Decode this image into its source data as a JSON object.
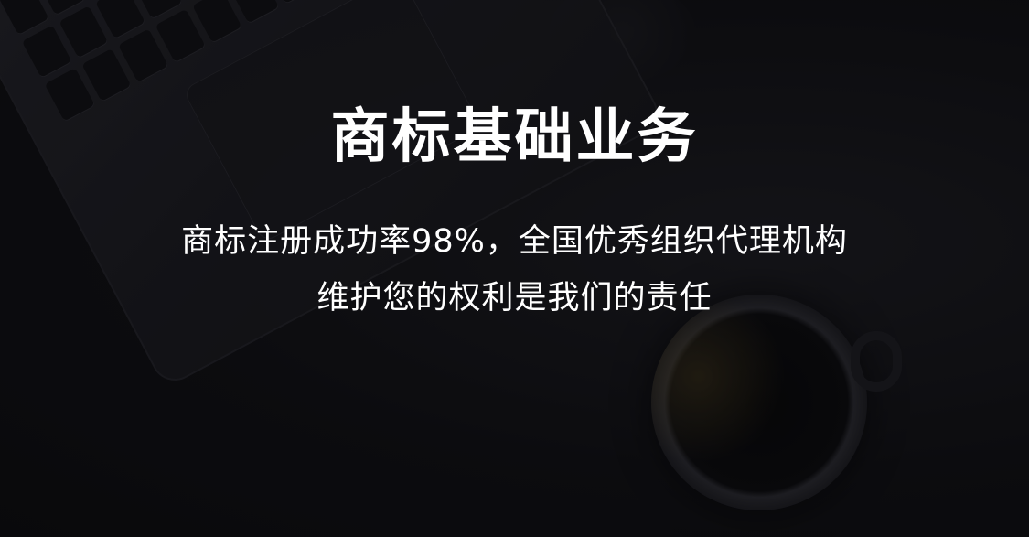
{
  "banner": {
    "title": "商标基础业务",
    "subtitle_line1": "商标注册成功率98%，全国优秀组织代理机构",
    "subtitle_line2": "维护您的权利是我们的责任"
  },
  "background": {
    "scene": "laptop-and-coffee-cup",
    "base_color": "#0f0f12",
    "text_color": "#ffffff"
  }
}
